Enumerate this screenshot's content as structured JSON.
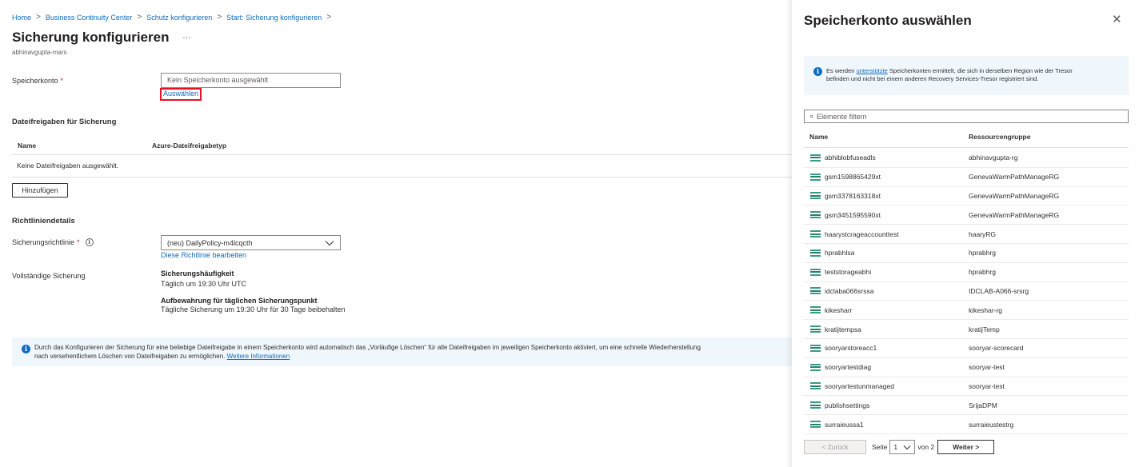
{
  "breadcrumb": [
    {
      "label": "Home"
    },
    {
      "label": "Business Continuity Center"
    },
    {
      "label": "Schutz konfigurieren"
    },
    {
      "label": "Start: Sicherung konfigurieren"
    }
  ],
  "breadcrumb_separator": ">",
  "page": {
    "title": "Sicherung konfigurieren",
    "more_icon": "…",
    "subtitle": "abhinavgupta-mars"
  },
  "storage_account": {
    "label": "Speicherkonto",
    "required_mark": "*",
    "placeholder": "Kein Speicherkonto ausgewählt",
    "select_link": "Auswählen"
  },
  "file_shares": {
    "title": "Dateifreigaben für Sicherung",
    "columns": [
      "Name",
      "Azure-Dateifreigabetyp"
    ],
    "empty_text": "Keine Dateifreigaben ausgewählt.",
    "add_button": "Hinzufügen"
  },
  "policy": {
    "title": "Richtliniendetails",
    "label": "Sicherungsrichtlinie",
    "required_mark": "*",
    "info_icon": "i",
    "selected": "(neu) DailyPolicy-m4lcqcth",
    "edit_link": "Diese Richtlinie bearbeiten",
    "full_backup_label": "Vollständige Sicherung",
    "frequency_title": "Sicherungshäufigkeit",
    "frequency_value": "Täglich um 19:30 Uhr UTC",
    "retention_title": "Aufbewahrung für täglichen Sicherungspunkt",
    "retention_value": "Tägliche Sicherung um 19:30 Uhr für 30 Tage beibehalten"
  },
  "info_banner": {
    "icon": "i",
    "text_line1": "Durch das Konfigurieren der Sicherung für eine beliebige Dateifreigabe in einem Speicherkonto wird automatisch das „Vorläufige Löschen“ für alle Dateifreigaben im jeweiligen Speicherkonto aktiviert, um eine schnelle Wiederherstellung",
    "text_line2": "nach versehentlichem Löschen von Dateifreigaben zu ermöglichen.",
    "link": "Weitere Informationen"
  },
  "panel": {
    "title": "Speicherkonto auswählen",
    "close_icon": "✕",
    "banner": {
      "icon": "i",
      "text_before": "Es werden ",
      "link": "unterstützte",
      "text_after_line1": " Speicherkonten ermittelt, die sich in derselben Region wie der Tresor",
      "text_line2": "befinden und nicht bei einem anderen Recovery Services-Tresor registriert sind."
    },
    "filter_placeholder": "Elemente filtern",
    "filter_icon": "⌕",
    "columns": {
      "name": "Name",
      "rg": "Ressourcengruppe"
    },
    "rows": [
      {
        "name": "abhiblobfuseadls",
        "rg": "abhinavgupta-rg"
      },
      {
        "name": "gsm1598865429xt",
        "rg": "GenevaWarmPathManageRG"
      },
      {
        "name": "gsm3378163318xt",
        "rg": "GenevaWarmPathManageRG"
      },
      {
        "name": "gsm3451595590xt",
        "rg": "GenevaWarmPathManageRG"
      },
      {
        "name": "haarystcrageaccounttest",
        "rg": "haaryRG"
      },
      {
        "name": "hprabhlsa",
        "rg": "hprabhrg"
      },
      {
        "name": "teststorageabhi",
        "rg": "hprabhrg"
      },
      {
        "name": "idclaba066srssa",
        "rg": "IDCLAB-A066-srsrg"
      },
      {
        "name": "kikesharr",
        "rg": "kikeshar-rg"
      },
      {
        "name": "kratijtempsa",
        "rg": "kratijTemp"
      },
      {
        "name": "sooryarstoreacc1",
        "rg": "sooryar-scorecard"
      },
      {
        "name": "sooryartestdiag",
        "rg": "sooryar-test"
      },
      {
        "name": "sooryartestunmanaged",
        "rg": "sooryar-test"
      },
      {
        "name": "publishsettings",
        "rg": "SrijaDPM"
      },
      {
        "name": "surraieussa1",
        "rg": "surraieustestrg"
      }
    ],
    "pager": {
      "prev": "< Zurück",
      "page_label": "Seite",
      "current_page": "1",
      "of_label": "von 2",
      "next": "Weiter >"
    }
  }
}
